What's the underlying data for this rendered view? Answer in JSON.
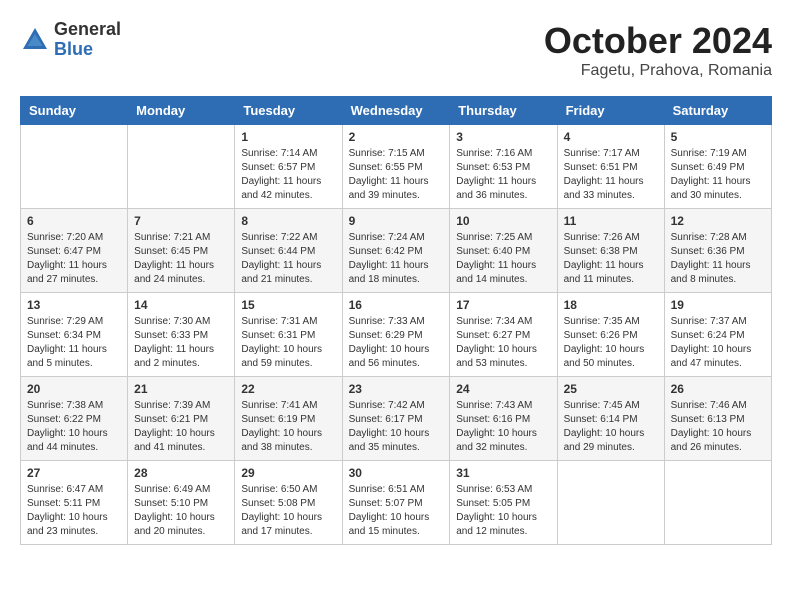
{
  "logo": {
    "general": "General",
    "blue": "Blue"
  },
  "header": {
    "month": "October 2024",
    "location": "Fagetu, Prahova, Romania"
  },
  "days_of_week": [
    "Sunday",
    "Monday",
    "Tuesday",
    "Wednesday",
    "Thursday",
    "Friday",
    "Saturday"
  ],
  "weeks": [
    [
      {
        "day": "",
        "content": ""
      },
      {
        "day": "",
        "content": ""
      },
      {
        "day": "1",
        "content": "Sunrise: 7:14 AM\nSunset: 6:57 PM\nDaylight: 11 hours and 42 minutes."
      },
      {
        "day": "2",
        "content": "Sunrise: 7:15 AM\nSunset: 6:55 PM\nDaylight: 11 hours and 39 minutes."
      },
      {
        "day": "3",
        "content": "Sunrise: 7:16 AM\nSunset: 6:53 PM\nDaylight: 11 hours and 36 minutes."
      },
      {
        "day": "4",
        "content": "Sunrise: 7:17 AM\nSunset: 6:51 PM\nDaylight: 11 hours and 33 minutes."
      },
      {
        "day": "5",
        "content": "Sunrise: 7:19 AM\nSunset: 6:49 PM\nDaylight: 11 hours and 30 minutes."
      }
    ],
    [
      {
        "day": "6",
        "content": "Sunrise: 7:20 AM\nSunset: 6:47 PM\nDaylight: 11 hours and 27 minutes."
      },
      {
        "day": "7",
        "content": "Sunrise: 7:21 AM\nSunset: 6:45 PM\nDaylight: 11 hours and 24 minutes."
      },
      {
        "day": "8",
        "content": "Sunrise: 7:22 AM\nSunset: 6:44 PM\nDaylight: 11 hours and 21 minutes."
      },
      {
        "day": "9",
        "content": "Sunrise: 7:24 AM\nSunset: 6:42 PM\nDaylight: 11 hours and 18 minutes."
      },
      {
        "day": "10",
        "content": "Sunrise: 7:25 AM\nSunset: 6:40 PM\nDaylight: 11 hours and 14 minutes."
      },
      {
        "day": "11",
        "content": "Sunrise: 7:26 AM\nSunset: 6:38 PM\nDaylight: 11 hours and 11 minutes."
      },
      {
        "day": "12",
        "content": "Sunrise: 7:28 AM\nSunset: 6:36 PM\nDaylight: 11 hours and 8 minutes."
      }
    ],
    [
      {
        "day": "13",
        "content": "Sunrise: 7:29 AM\nSunset: 6:34 PM\nDaylight: 11 hours and 5 minutes."
      },
      {
        "day": "14",
        "content": "Sunrise: 7:30 AM\nSunset: 6:33 PM\nDaylight: 11 hours and 2 minutes."
      },
      {
        "day": "15",
        "content": "Sunrise: 7:31 AM\nSunset: 6:31 PM\nDaylight: 10 hours and 59 minutes."
      },
      {
        "day": "16",
        "content": "Sunrise: 7:33 AM\nSunset: 6:29 PM\nDaylight: 10 hours and 56 minutes."
      },
      {
        "day": "17",
        "content": "Sunrise: 7:34 AM\nSunset: 6:27 PM\nDaylight: 10 hours and 53 minutes."
      },
      {
        "day": "18",
        "content": "Sunrise: 7:35 AM\nSunset: 6:26 PM\nDaylight: 10 hours and 50 minutes."
      },
      {
        "day": "19",
        "content": "Sunrise: 7:37 AM\nSunset: 6:24 PM\nDaylight: 10 hours and 47 minutes."
      }
    ],
    [
      {
        "day": "20",
        "content": "Sunrise: 7:38 AM\nSunset: 6:22 PM\nDaylight: 10 hours and 44 minutes."
      },
      {
        "day": "21",
        "content": "Sunrise: 7:39 AM\nSunset: 6:21 PM\nDaylight: 10 hours and 41 minutes."
      },
      {
        "day": "22",
        "content": "Sunrise: 7:41 AM\nSunset: 6:19 PM\nDaylight: 10 hours and 38 minutes."
      },
      {
        "day": "23",
        "content": "Sunrise: 7:42 AM\nSunset: 6:17 PM\nDaylight: 10 hours and 35 minutes."
      },
      {
        "day": "24",
        "content": "Sunrise: 7:43 AM\nSunset: 6:16 PM\nDaylight: 10 hours and 32 minutes."
      },
      {
        "day": "25",
        "content": "Sunrise: 7:45 AM\nSunset: 6:14 PM\nDaylight: 10 hours and 29 minutes."
      },
      {
        "day": "26",
        "content": "Sunrise: 7:46 AM\nSunset: 6:13 PM\nDaylight: 10 hours and 26 minutes."
      }
    ],
    [
      {
        "day": "27",
        "content": "Sunrise: 6:47 AM\nSunset: 5:11 PM\nDaylight: 10 hours and 23 minutes."
      },
      {
        "day": "28",
        "content": "Sunrise: 6:49 AM\nSunset: 5:10 PM\nDaylight: 10 hours and 20 minutes."
      },
      {
        "day": "29",
        "content": "Sunrise: 6:50 AM\nSunset: 5:08 PM\nDaylight: 10 hours and 17 minutes."
      },
      {
        "day": "30",
        "content": "Sunrise: 6:51 AM\nSunset: 5:07 PM\nDaylight: 10 hours and 15 minutes."
      },
      {
        "day": "31",
        "content": "Sunrise: 6:53 AM\nSunset: 5:05 PM\nDaylight: 10 hours and 12 minutes."
      },
      {
        "day": "",
        "content": ""
      },
      {
        "day": "",
        "content": ""
      }
    ]
  ]
}
